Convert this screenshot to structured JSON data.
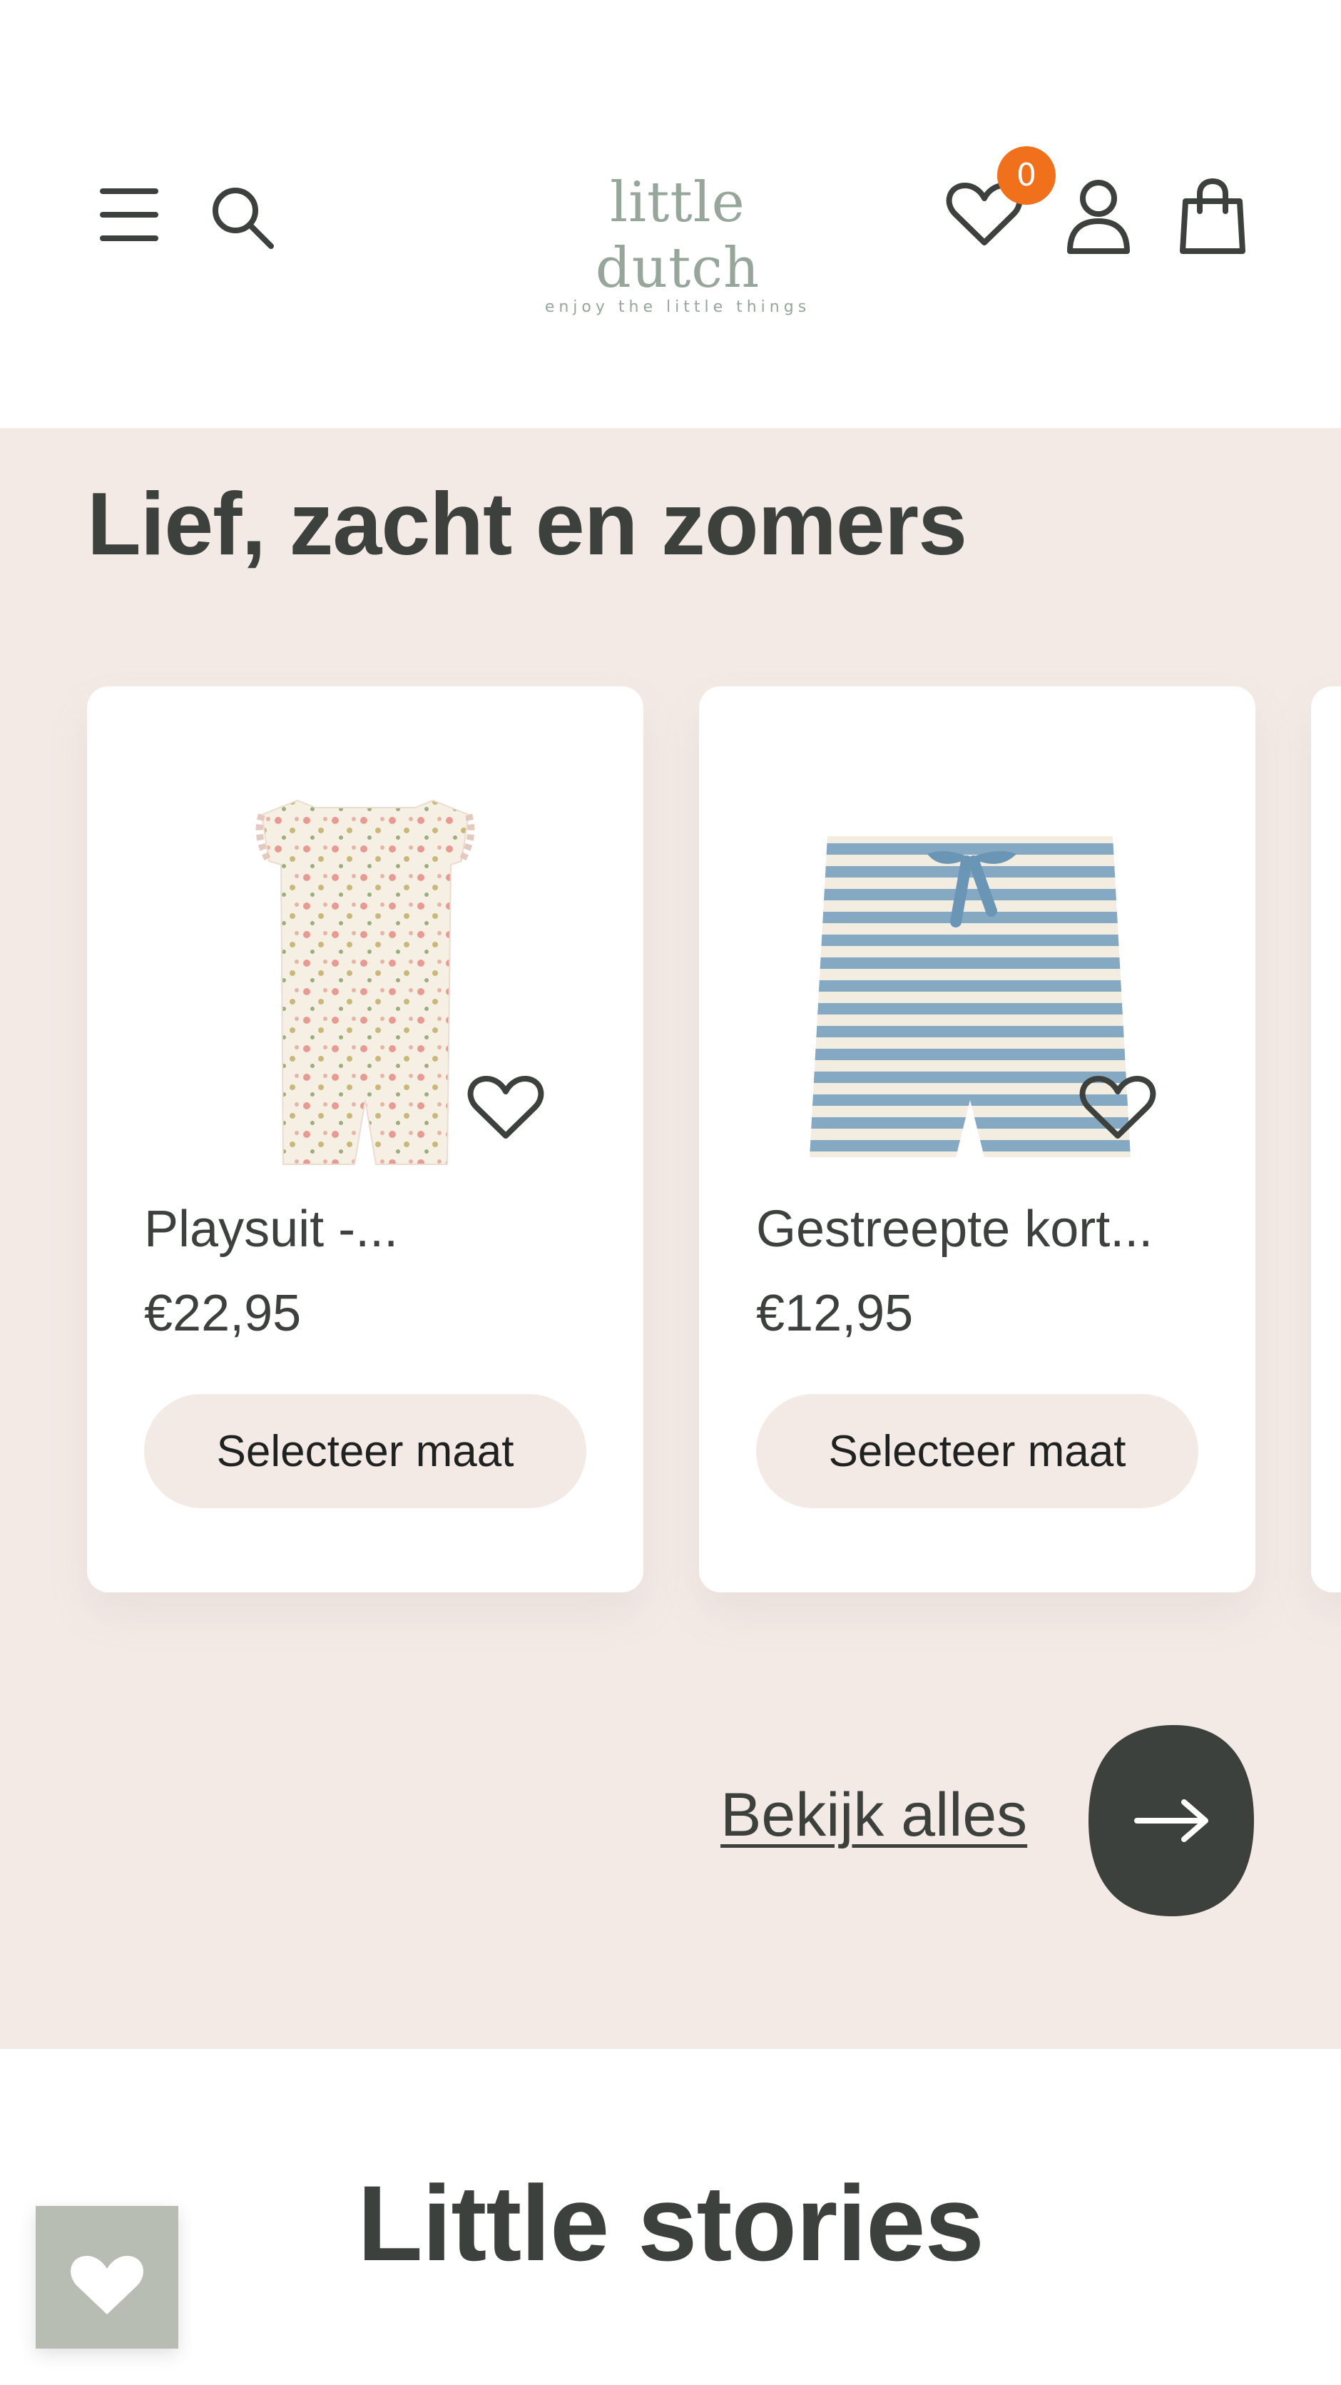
{
  "header": {
    "logo_text": "little dutch",
    "logo_tagline": "enjoy the little things",
    "wishlist_count": "0",
    "icons": [
      "menu-icon",
      "search-icon",
      "heart-icon",
      "account-icon",
      "bag-icon"
    ]
  },
  "section": {
    "title": "Lief, zacht en zomers",
    "products": [
      {
        "name": "Playsuit -...",
        "price": "€22,95",
        "button": "Selecteer maat"
      },
      {
        "name": "Gestreepte kort...",
        "price": "€12,95",
        "button": "Selecteer maat"
      }
    ],
    "view_all": "Bekijk alles"
  },
  "stories": {
    "title": "Little stories"
  },
  "colors": {
    "accent_badge": "#f0701c",
    "section_bg": "#f3eae6",
    "dark": "#3c413d",
    "logo": "#96a69a",
    "floating_wishlist": "#b7bdb3"
  }
}
